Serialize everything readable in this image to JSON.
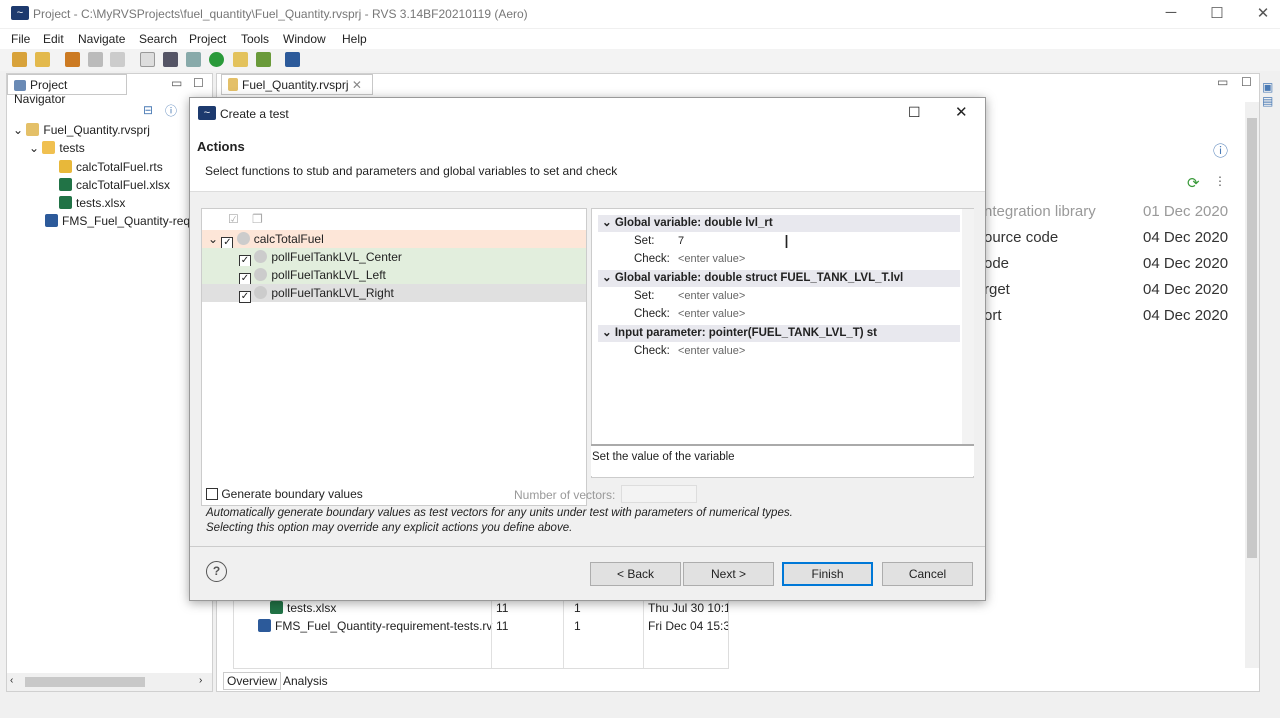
{
  "window": {
    "title": "Project - C:\\MyRVSProjects\\fuel_quantity\\Fuel_Quantity.rvsprj - RVS 3.14BF20210119 (Aero)",
    "minimize": "─",
    "maximize": "☐",
    "close": "✕"
  },
  "menu": [
    "File",
    "Edit",
    "Navigate",
    "Search",
    "Project",
    "Tools",
    "Window",
    "Help"
  ],
  "navigator": {
    "title": "Project Navigator",
    "tree": [
      {
        "label": "Fuel_Quantity.rvsprj",
        "icon": "project-file-icon"
      },
      {
        "label": "tests",
        "icon": "folder-icon"
      },
      {
        "label": "calcTotalFuel.rts",
        "icon": "package-icon"
      },
      {
        "label": "calcTotalFuel.xlsx",
        "icon": "excel-icon"
      },
      {
        "label": "tests.xlsx",
        "icon": "excel-icon"
      },
      {
        "label": "FMS_Fuel_Quantity-req",
        "icon": "report-icon"
      }
    ]
  },
  "editor": {
    "tab": "Fuel_Quantity.rvsprj",
    "list": [
      {
        "name": "ntegration library",
        "date": "01 Dec 2020",
        "muted": true
      },
      {
        "name": "ource code",
        "date": "04 Dec 2020"
      },
      {
        "name": "ode",
        "date": "04 Dec 2020"
      },
      {
        "name": "rget",
        "date": "04 Dec 2020"
      },
      {
        "name": "ort",
        "date": "04 Dec 2020"
      }
    ],
    "table": [
      [
        "tests.xlsx",
        "11",
        "1",
        "Thu Jul 30 10:1!"
      ],
      [
        "FMS_Fuel_Quantity-requirement-tests.rv",
        "11",
        "1",
        "Fri Dec 04 15:3t"
      ]
    ],
    "bottom_tabs": [
      "Overview",
      "Analysis"
    ]
  },
  "dialog": {
    "title": "Create a test",
    "heading": "Actions",
    "description": "Select functions to stub and parameters and global variables to set and check",
    "functions": [
      {
        "label": "calcTotalFuel",
        "checked": true
      },
      {
        "label": "pollFuelTankLVL_Center",
        "checked": true
      },
      {
        "label": "pollFuelTankLVL_Left",
        "checked": true
      },
      {
        "label": "pollFuelTankLVL_Right",
        "checked": true
      }
    ],
    "sections": [
      {
        "title": "Global variable: double lvl_rt",
        "fields": [
          {
            "label": "Set:",
            "value": "7",
            "placeholder": ""
          },
          {
            "label": "Check:",
            "value": "",
            "placeholder": "<enter value>"
          }
        ]
      },
      {
        "title": "Global variable: double struct FUEL_TANK_LVL_T.lvl",
        "fields": [
          {
            "label": "Set:",
            "value": "",
            "placeholder": "<enter value>"
          },
          {
            "label": "Check:",
            "value": "",
            "placeholder": "<enter value>"
          }
        ]
      },
      {
        "title": "Input parameter: pointer(FUEL_TANK_LVL_T) st",
        "fields": [
          {
            "label": "Check:",
            "value": "",
            "placeholder": "<enter value>"
          }
        ]
      }
    ],
    "hint": "Set the value of the variable",
    "boundary_label": "Generate boundary values",
    "boundary_checked": false,
    "vectors_label": "Number of vectors:",
    "boundary_note1": "Automatically generate boundary values as test vectors for any units under test with parameters of numerical types.",
    "boundary_note2": "Selecting this option may override any explicit actions you define above.",
    "buttons": {
      "back": "< Back",
      "next": "Next >",
      "finish": "Finish",
      "cancel": "Cancel"
    }
  }
}
